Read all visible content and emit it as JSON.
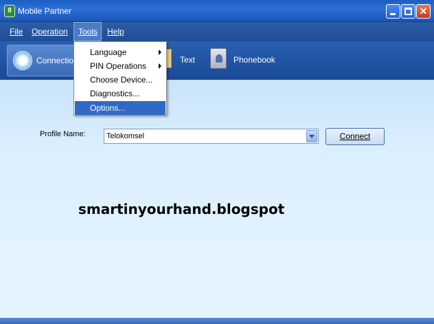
{
  "window": {
    "title": "Mobile Partner",
    "app_icon_glyph": "8"
  },
  "menubar": {
    "file": "File",
    "operation": "Operation",
    "tools": "Tools",
    "help": "Help"
  },
  "toolbar": {
    "connection": "Connection",
    "text": "Text",
    "phonebook": "Phonebook"
  },
  "tools_menu": {
    "items": [
      {
        "label": "Language",
        "has_submenu": true
      },
      {
        "label": "PIN Operations",
        "has_submenu": true
      },
      {
        "label": "Choose Device...",
        "has_submenu": false
      },
      {
        "label": "Diagnostics...",
        "has_submenu": false
      },
      {
        "label": "Options...",
        "has_submenu": false,
        "highlighted": true
      }
    ]
  },
  "profile": {
    "label": "Profile Name:",
    "selected": "Telokomsel",
    "connect_button": "Connect"
  },
  "watermark": "smartinyourhand.blogspot",
  "colors": {
    "titlebar": "#2b6fd6",
    "menubar": "#2d5da6",
    "content_bg": "#dcefff",
    "highlight": "#316ac5"
  }
}
